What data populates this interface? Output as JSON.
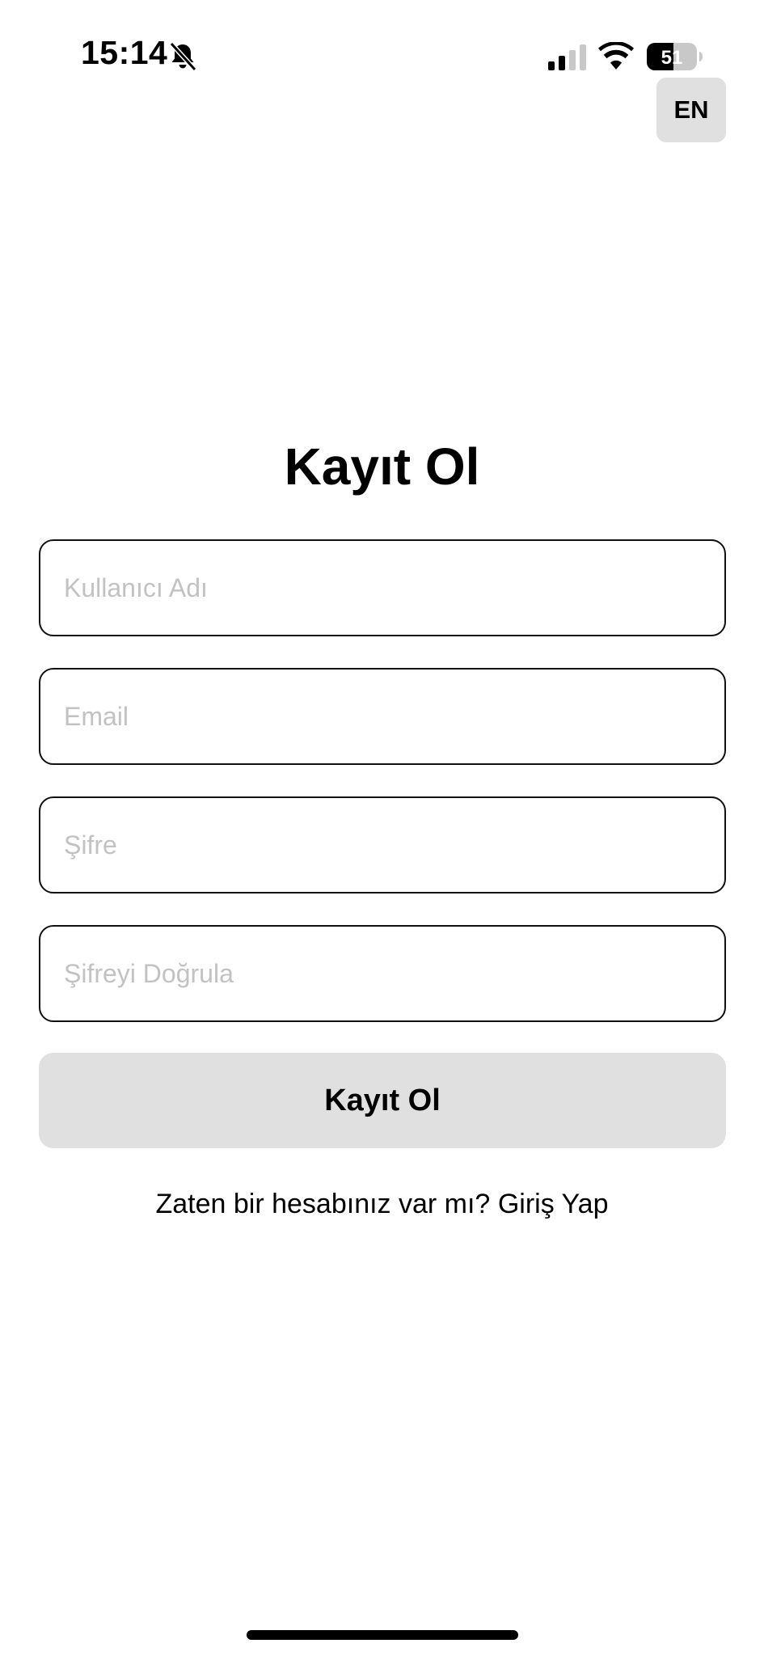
{
  "status_bar": {
    "time": "15:14",
    "battery_level": "51",
    "icons": [
      "bell-slash-icon",
      "cellular-signal-icon",
      "wifi-icon",
      "battery-icon"
    ]
  },
  "language_button": {
    "label": "EN"
  },
  "title": "Kayıt Ol",
  "form": {
    "username": {
      "placeholder": "Kullanıcı Adı",
      "value": ""
    },
    "email": {
      "placeholder": "Email",
      "value": ""
    },
    "password": {
      "placeholder": "Şifre",
      "value": ""
    },
    "confirm_password": {
      "placeholder": "Şifreyi Doğrula",
      "value": ""
    },
    "submit_label": "Kayıt Ol"
  },
  "login_prompt": {
    "text": "Zaten bir hesabınız var mı?",
    "link": "Giriş Yap"
  },
  "colors": {
    "background": "#ffffff",
    "button_bg": "#e0e0e0",
    "field_border": "#111111",
    "placeholder": "#c2c2c2"
  }
}
